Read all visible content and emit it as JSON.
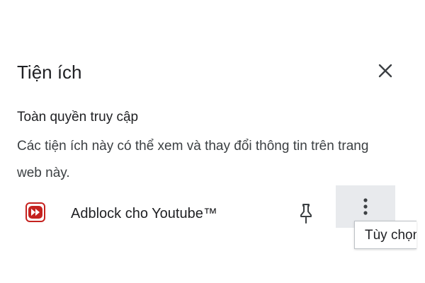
{
  "popup": {
    "title": "Tiện ích",
    "close_icon": "close-icon"
  },
  "section": {
    "heading": "Toàn quyền truy cập",
    "description": "Các tiện ích này có thể xem và thay đổi thông tin trên trang web này."
  },
  "extensions": [
    {
      "name": "Adblock cho Youtube™",
      "icon": "adblock-youtube-icon",
      "pin_icon": "pin-icon",
      "more_icon": "more-vert-icon"
    }
  ],
  "tooltip": {
    "text": "Tùy chọn"
  },
  "colors": {
    "icon_red": "#c5221f",
    "hover_bg": "#e8eaed",
    "text": "#202124"
  }
}
